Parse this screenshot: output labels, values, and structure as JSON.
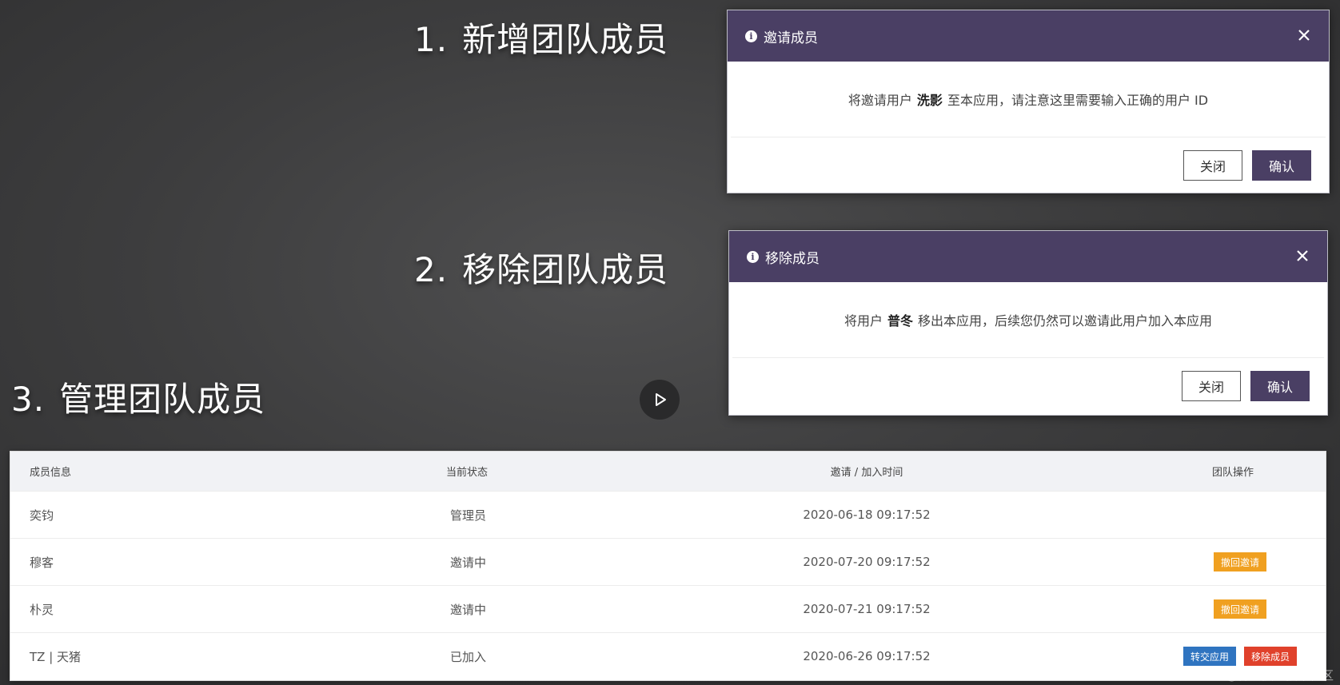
{
  "sections": [
    {
      "number": "1.",
      "title": "新增团队成员"
    },
    {
      "number": "2.",
      "title": "移除团队成员"
    },
    {
      "number": "3.",
      "title": "管理团队成员"
    }
  ],
  "invite_dialog": {
    "title": "邀请成员",
    "message_prefix": "将邀请用户",
    "user": "洗影",
    "message_suffix": "至本应用，请注意这里需要输入正确的用户 ID",
    "close_label": "关闭",
    "confirm_label": "确认"
  },
  "remove_dialog": {
    "title": "移除成员",
    "message_prefix": "将用户",
    "user": "普冬",
    "message_suffix": "移出本应用，后续您仍然可以邀请此用户加入本应用",
    "close_label": "关闭",
    "confirm_label": "确认"
  },
  "table": {
    "headers": [
      "成员信息",
      "当前状态",
      "邀请 / 加入时间",
      "团队操作"
    ],
    "rows": [
      {
        "member": "奕钧",
        "status": "管理员",
        "time": "2020-06-18 09:17:52",
        "actions": []
      },
      {
        "member": "穆客",
        "status": "邀请中",
        "time": "2020-07-20 09:17:52",
        "actions": [
          "撤回邀请"
        ]
      },
      {
        "member": "朴灵",
        "status": "邀请中",
        "time": "2020-07-21 09:17:52",
        "actions": [
          "撤回邀请"
        ]
      },
      {
        "member": "TZ | 天猪",
        "status": "已加入",
        "time": "2020-06-26 09:17:52",
        "actions": [
          "转交应用",
          "移除成员"
        ]
      }
    ]
  },
  "watermark": "@稀土掘金技术社区",
  "colors": {
    "dialog_header": "#4a3f64",
    "withdraw_button": "#f0a020",
    "transfer_button": "#2f74c0",
    "remove_button": "#e0412b"
  }
}
